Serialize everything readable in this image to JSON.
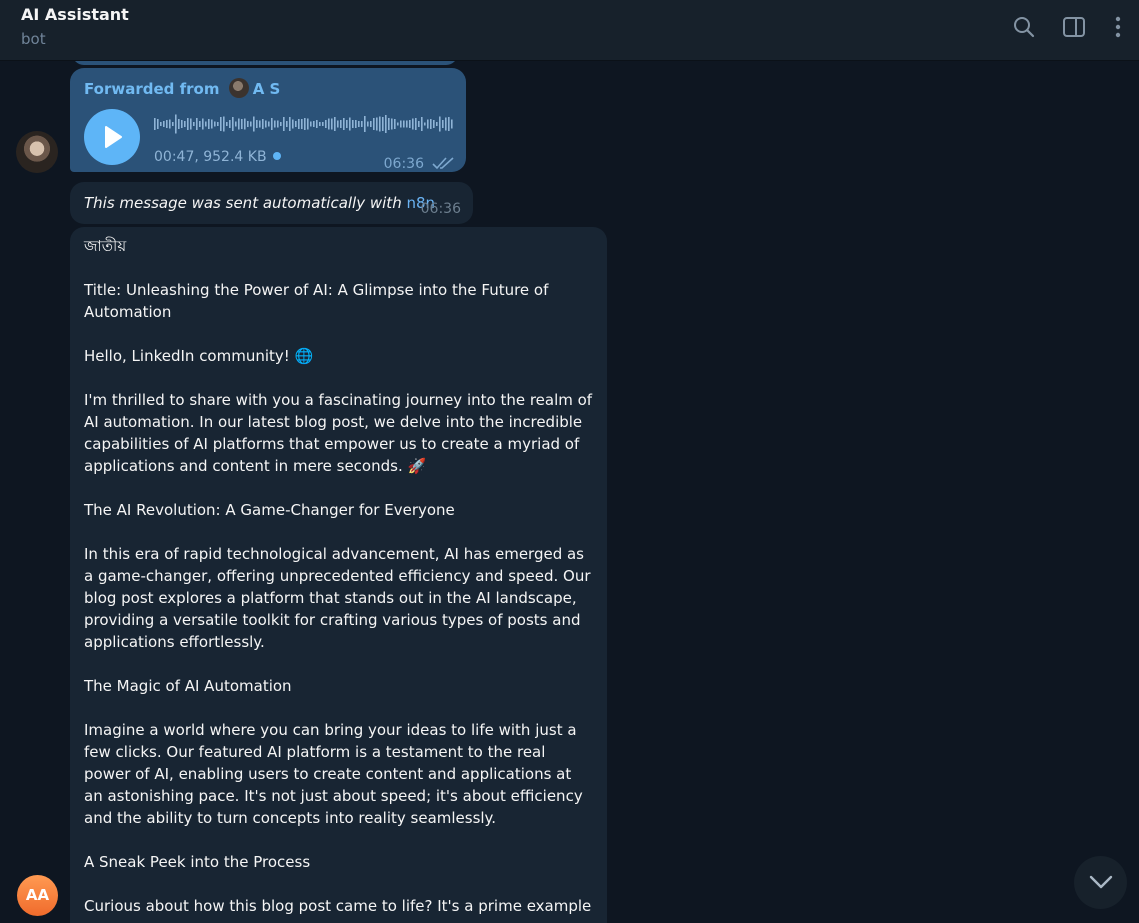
{
  "header": {
    "title": "AI Assistant",
    "subtitle": "bot",
    "icons": [
      "search-icon",
      "sidebar-toggle-icon",
      "more-vertical-icon"
    ]
  },
  "voice_message": {
    "forwarded_label": "Forwarded from",
    "forwarded_name": "A S",
    "meta": "00:47, 952.4 KB",
    "time": "06:36"
  },
  "auto_message": {
    "text": "This message was sent automatically with",
    "link": "n8n",
    "time": "06:36"
  },
  "post": {
    "paragraphs": [
      "জাতীয়",
      "Title: Unleashing the Power of AI: A Glimpse into the Future of Automation",
      "Hello, LinkedIn community! 🌐",
      "I'm thrilled to share with you a fascinating journey into the realm of AI automation. In our latest blog post, we delve into the incredible capabilities of AI platforms that empower us to create a myriad of applications and content in mere seconds. 🚀",
      "The AI Revolution: A Game-Changer for Everyone",
      "In this era of rapid technological advancement, AI has emerged as a game-changer, offering unprecedented efficiency and speed. Our blog post explores a platform that stands out in the AI landscape, providing a versatile toolkit for crafting various types of posts and applications effortlessly.",
      "The Magic of AI Automation",
      "Imagine a world where you can bring your ideas to life with just a few clicks. Our featured AI platform is a testament to the real power of AI, enabling users to create content and applications at an astonishing pace. It's not just about speed; it's about efficiency and the ability to turn concepts into reality seamlessly.",
      "A Sneak Peek into the Process",
      "Curious about how this blog post came to life? It's a prime example"
    ]
  },
  "user_avatar": {
    "initials": "AA"
  },
  "colors": {
    "background": "#0e1621",
    "header": "#17212b",
    "outgoing_bubble": "#2b5278",
    "incoming_bubble": "#182533",
    "accent": "#5eb5f7",
    "avatar": "#f27c3a"
  }
}
